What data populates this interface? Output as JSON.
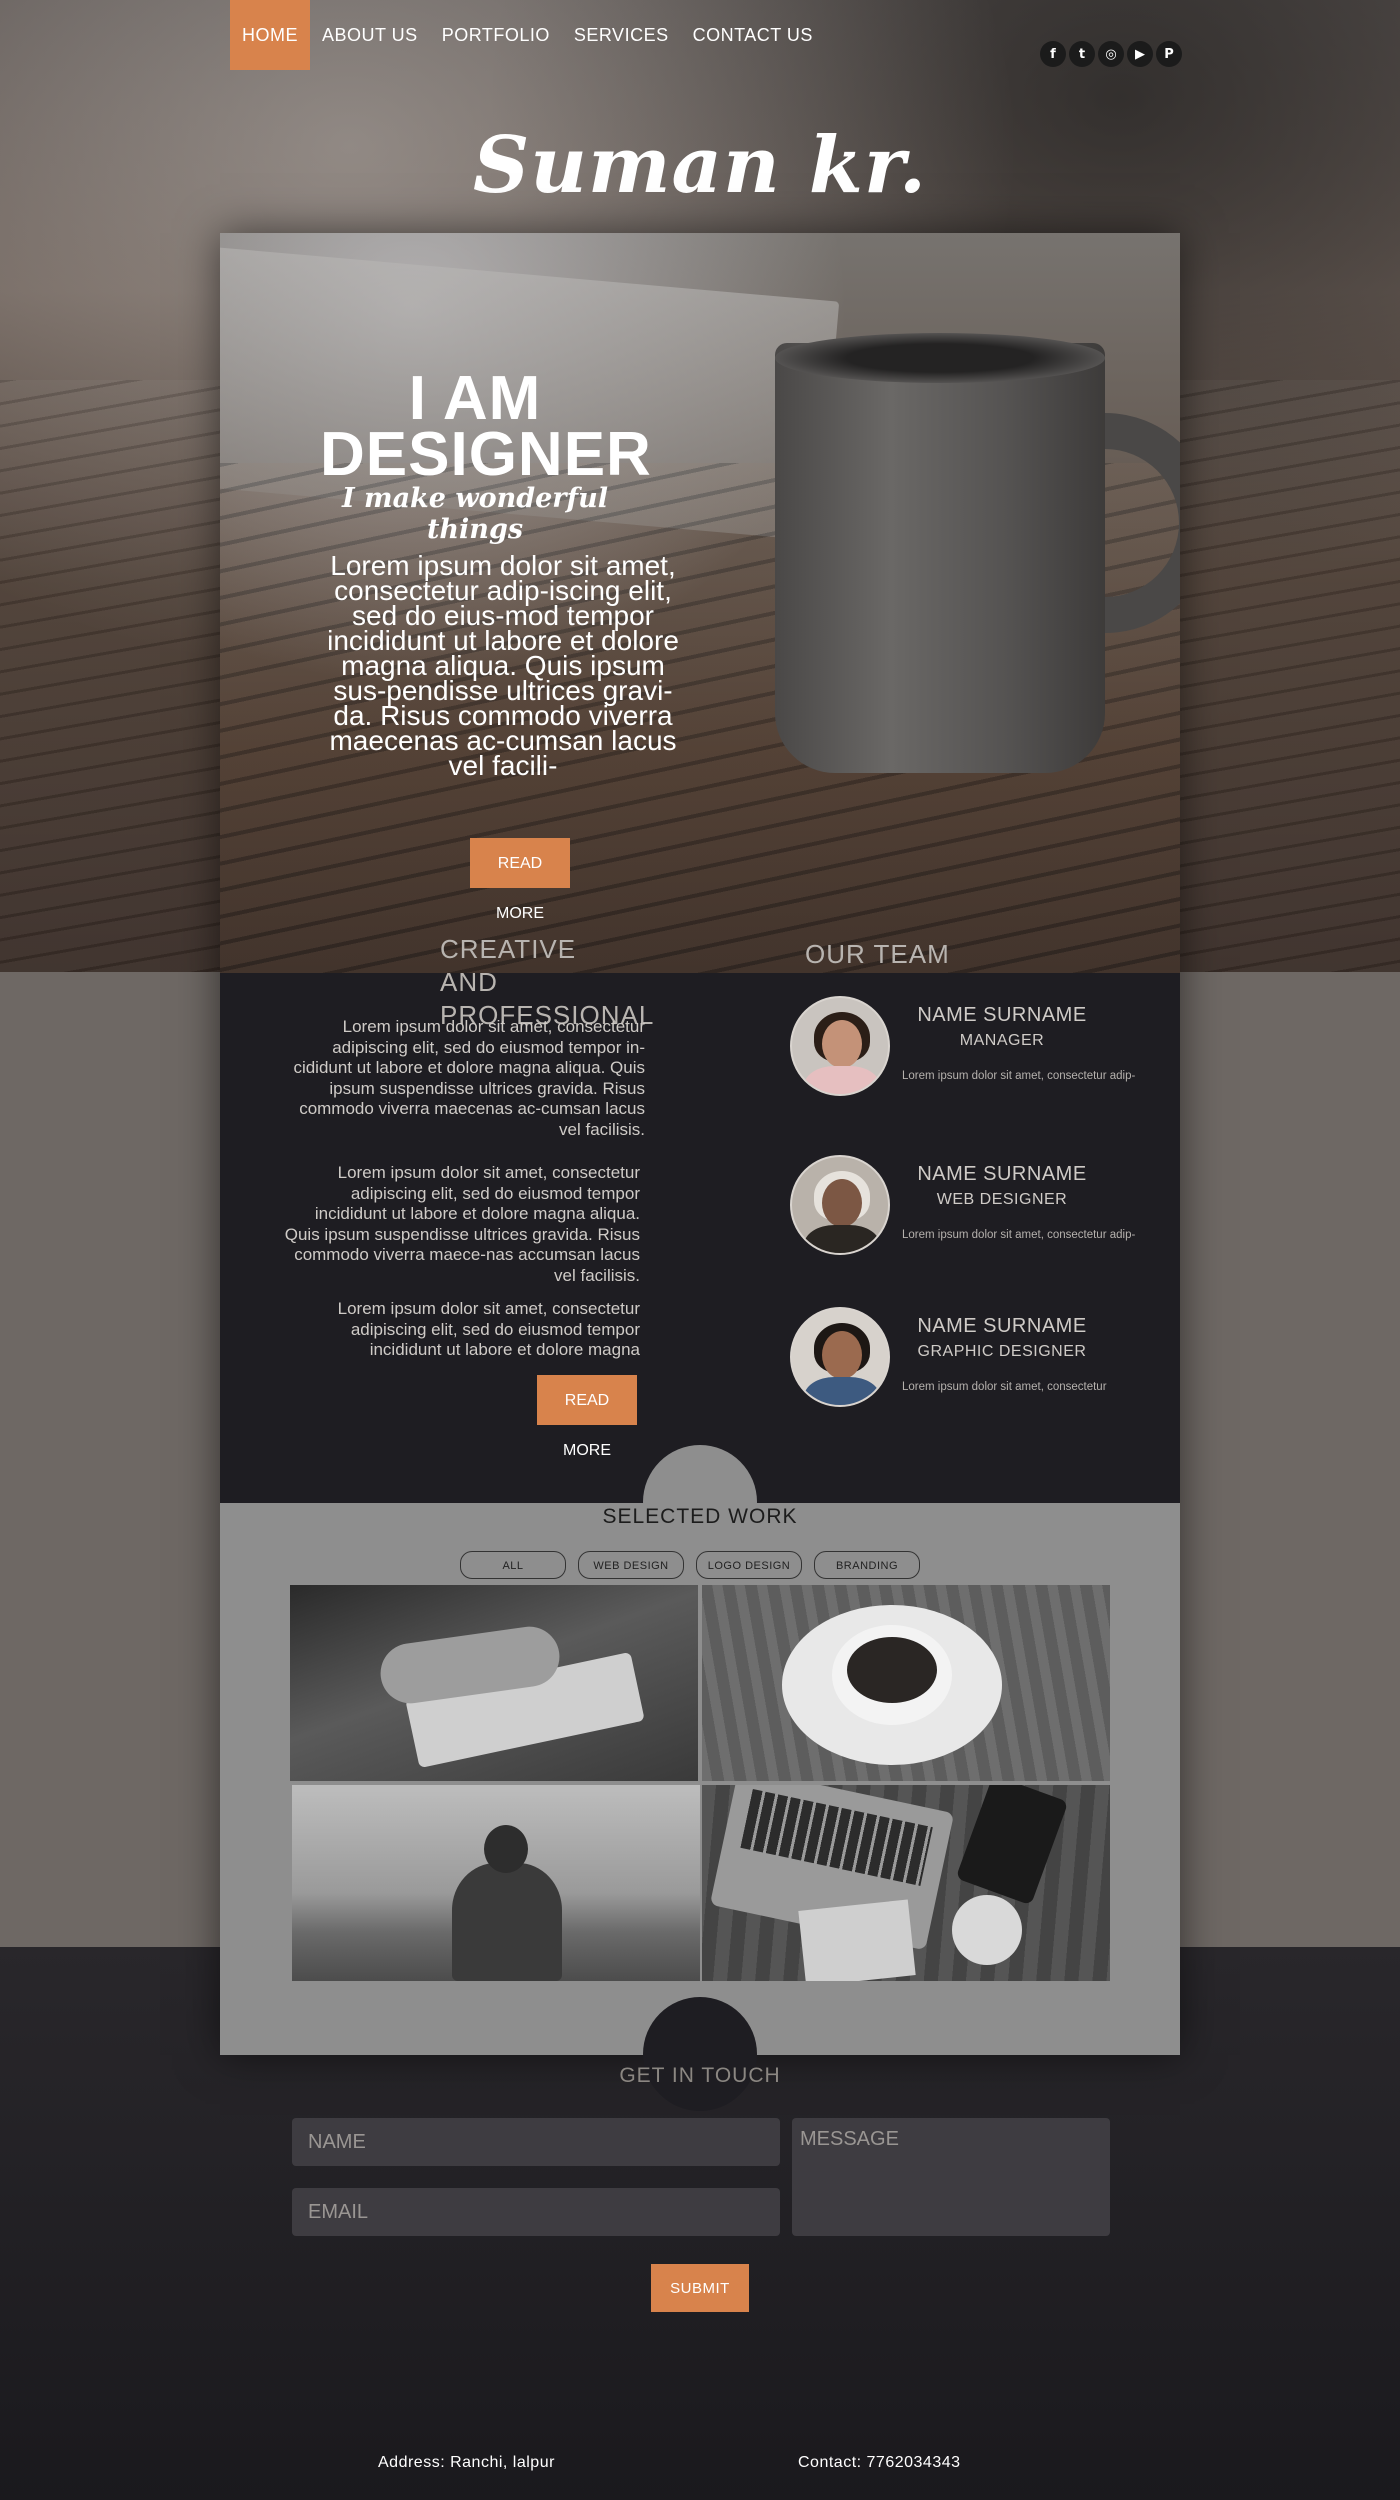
{
  "nav": {
    "items": [
      "HOME",
      "ABOUT US",
      "PORTFOLIO",
      "SERVICES",
      "CONTACT US"
    ],
    "active": "HOME"
  },
  "social": {
    "icons": [
      "facebook-icon",
      "twitter-icon",
      "instagram-icon",
      "youtube-icon",
      "pinterest-icon"
    ],
    "glyphs": [
      "f",
      "t",
      "◎",
      "▶",
      "P"
    ]
  },
  "logo": "Suman kr.",
  "hero": {
    "title_line1": "I AM",
    "title_line2": "DESIGNER",
    "subtitle": "I make wonderful things",
    "text": "Lorem ipsum dolor sit amet, consectetur adip-iscing elit, sed do eius-mod tempor incididunt ut labore et dolore magna aliqua. Quis ipsum sus-pendisse ultrices gravi-da. Risus commodo viverra maecenas ac-cumsan lacus vel facili-",
    "button": "READ MORE"
  },
  "creative": {
    "title": "CREATIVE AND PROFESSIONAL",
    "para1": "Lorem ipsum dolor sit amet, consectetur adipiscing elit, sed do eiusmod tempor in-cididunt ut labore et dolore magna aliqua. Quis ipsum suspendisse ultrices gravida. Risus commodo viverra maecenas ac-cumsan lacus vel facilisis.",
    "para2": "Lorem ipsum dolor sit amet, consectetur adipiscing elit, sed do eiusmod tempor incididunt ut labore et dolore magna aliqua. Quis ipsum suspendisse ultrices gravida. Risus commodo viverra maece-nas accumsan lacus vel facilisis.",
    "para3": "Lorem ipsum dolor sit amet, consectetur adipiscing elit, sed do eiusmod tempor incididunt ut labore et dolore magna",
    "button": "READ MORE"
  },
  "team": {
    "title": "OUR TEAM",
    "members": [
      {
        "name": "NAME SURNAME",
        "role": "MANAGER",
        "desc": "Lorem ipsum dolor sit amet, consectetur adip-"
      },
      {
        "name": "NAME SURNAME",
        "role": "WEB DESIGNER",
        "desc": "Lorem ipsum dolor sit amet, consectetur adip-"
      },
      {
        "name": "NAME SURNAME",
        "role": "GRAPHIC DESIGNER",
        "desc": "Lorem ipsum dolor sit amet, consectetur"
      }
    ]
  },
  "work": {
    "title": "SELECTED WORK",
    "filters": [
      "ALL",
      "WEB DESIGN",
      "LOGO DESIGN",
      "BRANDING"
    ]
  },
  "contact_form": {
    "title": "GET IN TOUCH",
    "name_placeholder": "NAME",
    "email_placeholder": "EMAIL",
    "message_placeholder": "MESSAGE",
    "submit": "SUBMIT"
  },
  "footer": {
    "address": "Address: Ranchi, lalpur",
    "contact": "Contact: 7762034343"
  },
  "colors": {
    "accent": "#d8834c",
    "dark_section": "#1e1d22",
    "gray_section": "#8e8e8e"
  }
}
